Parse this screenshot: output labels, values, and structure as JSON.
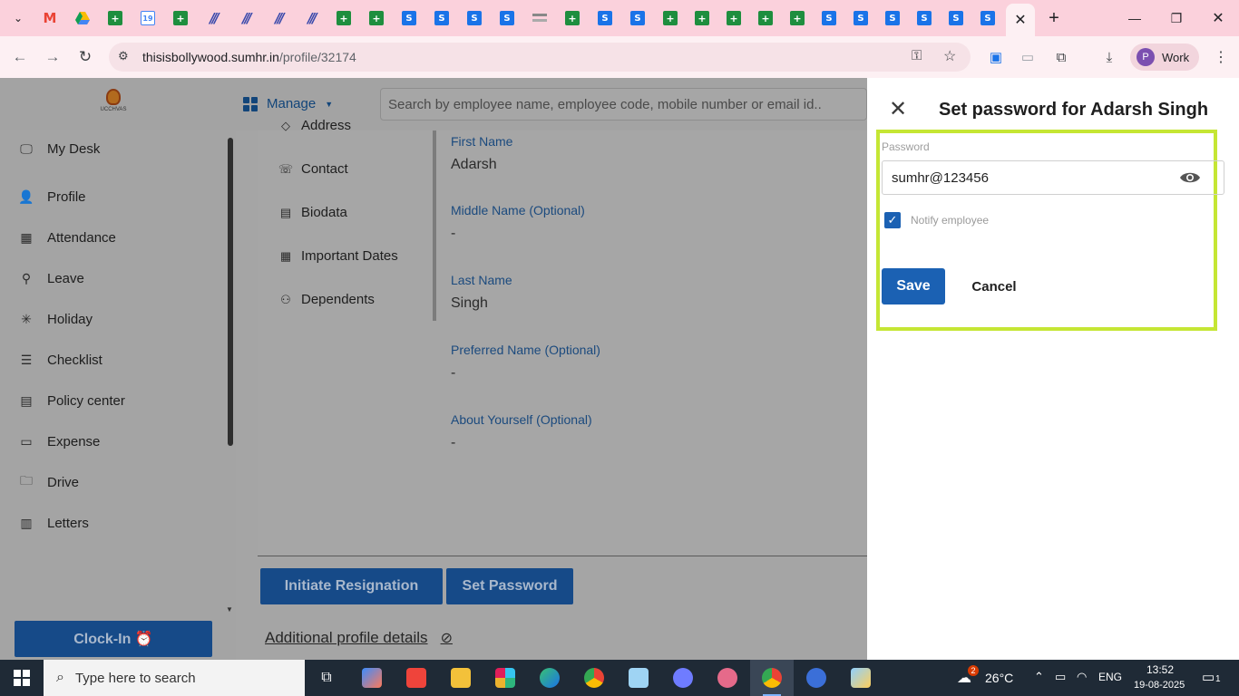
{
  "browser": {
    "active_tab_close": "✕",
    "new_tab": "+",
    "url_host": "thisisbollywood.sumhr.in",
    "url_path": "/profile/32174",
    "profile_label": "Work",
    "profile_initial": "P"
  },
  "app": {
    "logo_text": "UCCHVAS",
    "manage_label": "Manage",
    "search_placeholder": "Search by employee name, employee code, mobile number or email id.."
  },
  "sidebar": {
    "items": [
      {
        "label": "My Desk",
        "icon": "desktop-icon"
      },
      {
        "label": "Profile",
        "icon": "user-icon"
      },
      {
        "label": "Attendance",
        "icon": "calendar-icon"
      },
      {
        "label": "Leave",
        "icon": "leave-icon"
      },
      {
        "label": "Holiday",
        "icon": "holiday-icon"
      },
      {
        "label": "Checklist",
        "icon": "checklist-icon"
      },
      {
        "label": "Policy center",
        "icon": "policy-icon"
      },
      {
        "label": "Expense",
        "icon": "expense-icon"
      },
      {
        "label": "Drive",
        "icon": "folder-icon"
      },
      {
        "label": "Letters",
        "icon": "letters-icon"
      }
    ],
    "clock_in_label": "Clock-In ⏰"
  },
  "section_nav": {
    "partial_label": "Address",
    "items": [
      {
        "label": "Contact"
      },
      {
        "label": "Biodata"
      },
      {
        "label": "Important Dates"
      },
      {
        "label": "Dependents"
      }
    ]
  },
  "profile_fields": [
    {
      "label": "First Name",
      "value": "Adarsh"
    },
    {
      "label": "Middle Name (Optional)",
      "value": "-"
    },
    {
      "label": "Last Name",
      "value": "Singh"
    },
    {
      "label": "Preferred Name (Optional)",
      "value": "-"
    },
    {
      "label": "About Yourself (Optional)",
      "value": "-"
    }
  ],
  "actions": {
    "initiate_resignation": "Initiate Resignation",
    "set_password": "Set Password",
    "additional_details": "Additional profile details"
  },
  "panel": {
    "title": "Set password for Adarsh Singh",
    "password_label": "Password",
    "password_value": "sumhr@123456",
    "notify_label": "Notify employee",
    "notify_checked": true,
    "save_label": "Save",
    "cancel_label": "Cancel",
    "highlight_color": "#c5e634"
  },
  "taskbar": {
    "search_placeholder": "Type here to search",
    "weather_temp": "26°C",
    "weather_badge": "2",
    "language": "ENG",
    "time": "13:52",
    "date": "19-08-2025",
    "notification_count": "1"
  }
}
